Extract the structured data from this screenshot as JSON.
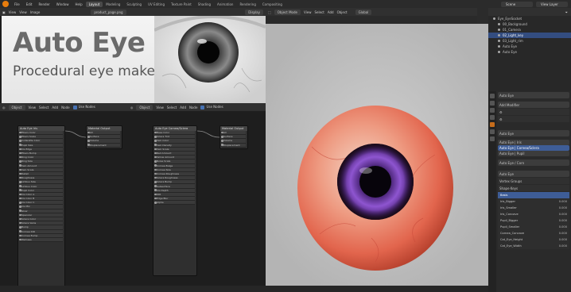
{
  "topbar": {
    "menus": [
      "File",
      "Edit",
      "Render",
      "Window",
      "Help"
    ],
    "workspaces": [
      "Layout",
      "Modeling",
      "Sculpting",
      "UV Editing",
      "Texture Paint",
      "Shading",
      "Animation",
      "Rendering",
      "Compositing"
    ],
    "active_workspace": "Layout",
    "scene_label": "Scene",
    "view_layer_label": "View Layer"
  },
  "image_editor": {
    "menus": [
      "View",
      "View",
      "Image"
    ],
    "image_name": "product_page.png",
    "display_mode": "Display",
    "banner": {
      "title": "Auto Eye",
      "subtitle": "Procedural eye maker"
    }
  },
  "node_editor": {
    "menus": [
      "Object",
      "View",
      "Select",
      "Add",
      "Node",
      "Use Nodes"
    ],
    "left": {
      "group_node_title": "Auto Eye Iris",
      "output_node_title": "Material Output",
      "rows": [
        "Fibers Color",
        "Fibers Scale",
        "Collarette Color",
        "Pupil Size",
        "Iris Edge",
        "Fibers Bump",
        "Ring Color",
        "Ring Size",
        "Vein Amount",
        "Vein Scale",
        "Detail",
        "Roughness",
        "Limbus Size",
        "Limbus Color",
        "Pupil Color",
        "Iris Color A",
        "Iris Color B",
        "Iris Color C",
        "Iris Mix",
        "Glow",
        "Specular",
        "Sclera Color",
        "Sclera Veins",
        "Bump",
        "Cornea IOR",
        "Cornea Bump",
        "Wetness"
      ],
      "output_rows": [
        "All",
        "Surface",
        "Volume",
        "Displacement"
      ]
    },
    "right": {
      "group_node_title": "Auto Eye Cornea/Sclera",
      "output_node_title": "Material Output",
      "rows": [
        "Base Color",
        "Sclera Tint",
        "Vein Color",
        "Vein Density",
        "Vein Scale",
        "Red Amount",
        "Yellow Amount",
        "Noise Scale",
        "Cornea Bulge",
        "Cornea Size",
        "Cornea Roughness",
        "Sclera Roughness",
        "Sclera Bump",
        "Subsurface",
        "Iris Depth",
        "IOR",
        "Edge Blur",
        "Alpha"
      ],
      "output_rows": [
        "All",
        "Surface",
        "Volume",
        "Displacement"
      ]
    }
  },
  "viewport": {
    "mode": "Object Mode",
    "menus": [
      "View",
      "Select",
      "Add",
      "Object"
    ],
    "orientation": "Global"
  },
  "outliner": {
    "rows": [
      {
        "label": "Eye_EyeSocket",
        "selected": false
      },
      {
        "label": "00_Background",
        "selected": false
      },
      {
        "label": "01_Camera",
        "selected": false
      },
      {
        "label": "02_Light_key",
        "selected": true
      },
      {
        "label": "03_Light_rim",
        "selected": false
      },
      {
        "label": "Auto Eye",
        "selected": false
      },
      {
        "label": "Auto Eye",
        "selected": false
      }
    ]
  },
  "properties": {
    "object_name": "Auto Eye",
    "add_modifier": "Add Modifier",
    "mat_section": "Auto Eye",
    "materials": [
      "Auto Eye | Iris",
      "Auto Eye | Cornea/Sclera",
      "Auto Eye | Pupil"
    ],
    "selected_material": "Auto Eye | Cornea/Sclera",
    "material_field": "Auto Eye / Corn",
    "data_name": "Auto Eye",
    "vertex_groups": "Vertex Groups",
    "shape_keys_label": "Shape Keys",
    "shape_keys": [
      {
        "name": "Basis",
        "value": ""
      },
      {
        "name": "Iris_Bigger",
        "value": "0.000"
      },
      {
        "name": "Iris_Smaller",
        "value": "0.000"
      },
      {
        "name": "Iris_Concave",
        "value": "0.000"
      },
      {
        "name": "Pupil_Bigger",
        "value": "0.000"
      },
      {
        "name": "Pupil_Smaller",
        "value": "0.000"
      },
      {
        "name": "Cornea_Concave",
        "value": "0.000"
      },
      {
        "name": "Cat_Eye_Height",
        "value": "0.000"
      },
      {
        "name": "Cat_Eye_Width",
        "value": "0.000"
      }
    ]
  },
  "colors": {
    "accent_orange": "#e87d0d",
    "selection_blue": "#3e5d97",
    "iris_purple": "#7a3fb8",
    "sclera_red": "#e06a58"
  }
}
